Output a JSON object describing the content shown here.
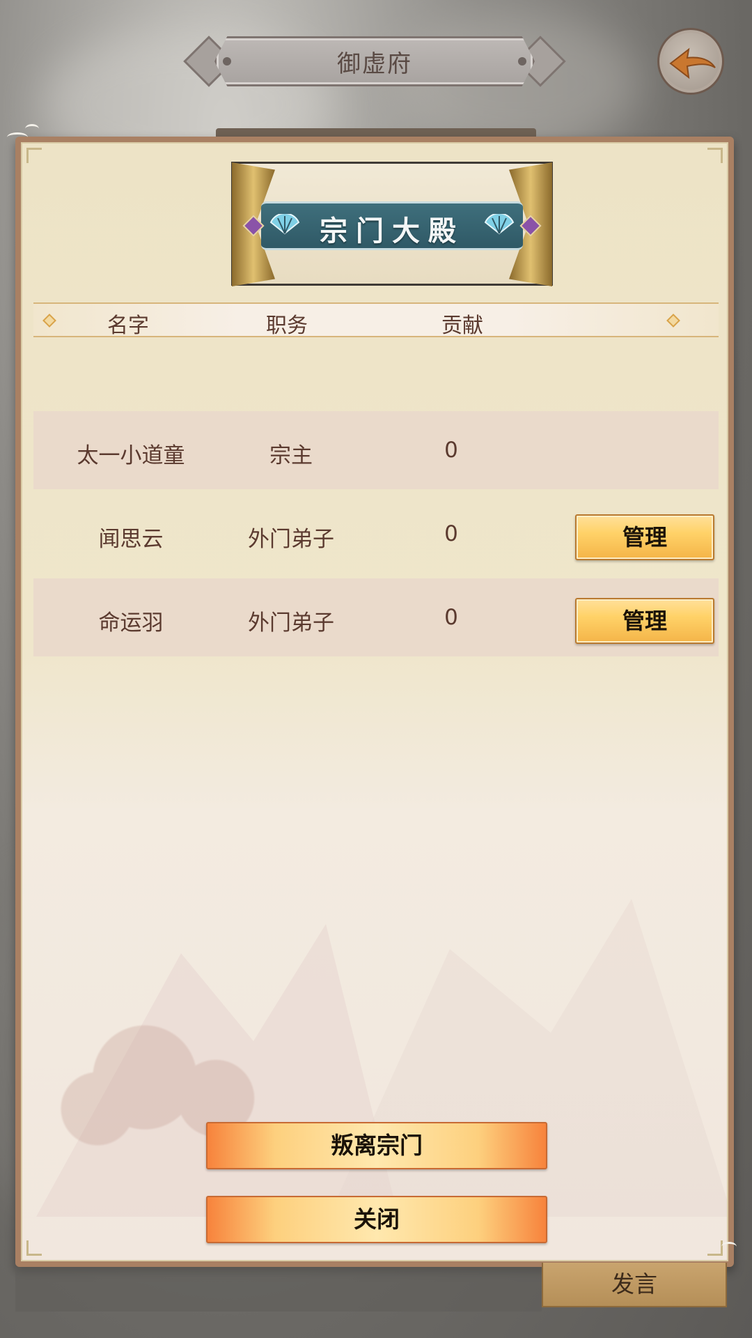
{
  "header": {
    "location_title": "御虚府"
  },
  "panel": {
    "banner_title": "宗门大殿",
    "columns": [
      "名字",
      "职务",
      "贡献"
    ],
    "members": [
      {
        "name": "太一小道童",
        "role": "宗主",
        "contribution": "0",
        "manage_label": ""
      },
      {
        "name": "闻思云",
        "role": "外门弟子",
        "contribution": "0",
        "manage_label": "管理"
      },
      {
        "name": "命运羽",
        "role": "外门弟子",
        "contribution": "0",
        "manage_label": "管理"
      }
    ],
    "leave_button": "叛离宗门",
    "close_button": "关闭"
  },
  "chat": {
    "speak_label": "发言"
  },
  "icons": {
    "back": "back-arrow-icon",
    "banner_fan": "fan-icon",
    "banner_gem": "gem-icon"
  },
  "colors": {
    "button_gold": "#ffd268",
    "button_orange": "#f7833c",
    "banner_plate": "#2f5966",
    "text_brown": "#5b3a2f"
  }
}
